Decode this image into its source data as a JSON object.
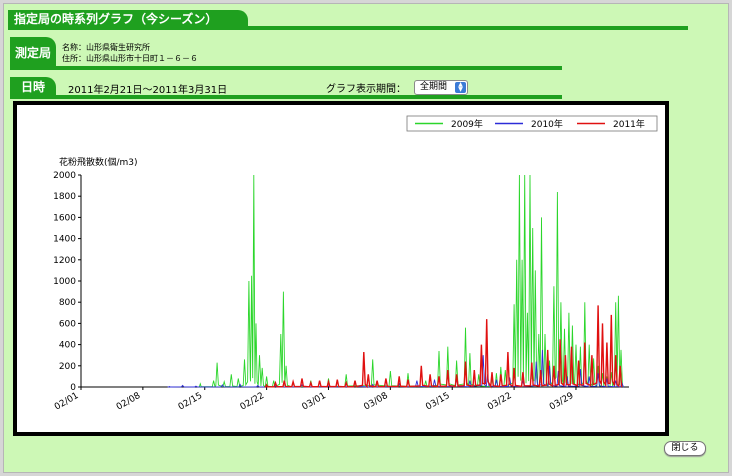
{
  "header": {
    "title": "指定局の時系列グラフ（今シーズン）"
  },
  "station": {
    "label": "測定局",
    "name": "名称：山形県衛生研究所",
    "address": "住所：山形県山形市十日町１－６－６"
  },
  "period": {
    "label": "日時",
    "range": "2011年2月21日～2011年3月31日",
    "display_label": "グラフ表示期間：",
    "display_value": "全期間"
  },
  "close_label": "閉じる",
  "colors": {
    "green": "#2bd62b",
    "blue": "#2c2cd8",
    "red": "#e01010",
    "accent": "#1fa01f"
  },
  "chart_data": {
    "type": "line",
    "ylabel": "花粉飛散数(個/m3)",
    "ylim": [
      0,
      2000
    ],
    "yticks": [
      "2000",
      "1800",
      "1600",
      "1400",
      "1200",
      "1000",
      "800",
      "600",
      "400",
      "200",
      "0"
    ],
    "xticks": [
      "02/01",
      "02/08",
      "02/15",
      "02/22",
      "03/01",
      "03/08",
      "03/15",
      "03/22",
      "03/29"
    ],
    "xlim_days": [
      0,
      62
    ],
    "legend_position": "top-right",
    "series": [
      {
        "name": "2009年",
        "color": "#2bd62b",
        "peaks": [
          [
            13.5,
            30
          ],
          [
            15.0,
            60
          ],
          [
            15.4,
            230
          ],
          [
            16.2,
            50
          ],
          [
            17.0,
            120
          ],
          [
            17.8,
            80
          ],
          [
            18.5,
            260
          ],
          [
            19.0,
            1000
          ],
          [
            19.3,
            1050
          ],
          [
            19.55,
            2000
          ],
          [
            19.8,
            600
          ],
          [
            20.2,
            300
          ],
          [
            20.5,
            180
          ],
          [
            21.0,
            100
          ],
          [
            21.8,
            60
          ],
          [
            22.6,
            500
          ],
          [
            22.9,
            900
          ],
          [
            23.2,
            200
          ],
          [
            24.0,
            40
          ],
          [
            26.0,
            60
          ],
          [
            28.0,
            80
          ],
          [
            30.0,
            120
          ],
          [
            33.0,
            260
          ],
          [
            35.0,
            150
          ],
          [
            37.0,
            130
          ],
          [
            39.0,
            60
          ],
          [
            40.5,
            340
          ],
          [
            41.5,
            380
          ],
          [
            42.5,
            250
          ],
          [
            43.5,
            560
          ],
          [
            44.0,
            320
          ],
          [
            45.0,
            120
          ],
          [
            46.5,
            80
          ],
          [
            47.0,
            130
          ],
          [
            47.5,
            190
          ],
          [
            48.0,
            160
          ],
          [
            49.0,
            780
          ],
          [
            49.3,
            1200
          ],
          [
            49.6,
            2000
          ],
          [
            49.9,
            1200
          ],
          [
            50.2,
            2000
          ],
          [
            50.5,
            700
          ],
          [
            50.8,
            2000
          ],
          [
            51.1,
            1500
          ],
          [
            51.4,
            1100
          ],
          [
            51.8,
            500
          ],
          [
            52.1,
            1600
          ],
          [
            52.5,
            500
          ],
          [
            53.0,
            250
          ],
          [
            53.5,
            950
          ],
          [
            53.9,
            1840
          ],
          [
            54.3,
            800
          ],
          [
            54.7,
            550
          ],
          [
            55.2,
            700
          ],
          [
            55.6,
            580
          ],
          [
            56.0,
            400
          ],
          [
            56.5,
            380
          ],
          [
            57.0,
            800
          ],
          [
            57.5,
            400
          ],
          [
            58.0,
            270
          ],
          [
            58.5,
            200
          ],
          [
            59.0,
            130
          ],
          [
            59.5,
            100
          ],
          [
            60.0,
            140
          ],
          [
            60.5,
            800
          ],
          [
            60.8,
            860
          ],
          [
            61.1,
            350
          ]
        ]
      },
      {
        "name": "2010年",
        "color": "#2c2cd8",
        "peaks": [
          [
            10.0,
            5
          ],
          [
            11.5,
            15
          ],
          [
            13.0,
            8
          ],
          [
            16.0,
            20
          ],
          [
            18.0,
            25
          ],
          [
            20.0,
            15
          ],
          [
            22.0,
            10
          ],
          [
            25.0,
            20
          ],
          [
            28.0,
            10
          ],
          [
            31.0,
            60
          ],
          [
            33.0,
            25
          ],
          [
            36.0,
            30
          ],
          [
            38.0,
            60
          ],
          [
            40.0,
            70
          ],
          [
            42.5,
            80
          ],
          [
            44.0,
            60
          ],
          [
            45.5,
            300
          ],
          [
            46.0,
            120
          ],
          [
            47.0,
            70
          ],
          [
            48.5,
            90
          ],
          [
            50.0,
            60
          ],
          [
            51.5,
            240
          ],
          [
            52.2,
            350
          ],
          [
            53.0,
            200
          ],
          [
            54.0,
            150
          ],
          [
            55.0,
            100
          ],
          [
            56.5,
            170
          ],
          [
            57.5,
            100
          ],
          [
            58.5,
            130
          ],
          [
            59.5,
            80
          ],
          [
            60.5,
            60
          ],
          [
            61.2,
            40
          ]
        ]
      },
      {
        "name": "2011年",
        "color": "#e01010",
        "peaks": [
          [
            21.0,
            20
          ],
          [
            22.0,
            40
          ],
          [
            23.0,
            60
          ],
          [
            24.0,
            50
          ],
          [
            25.0,
            80
          ],
          [
            26.0,
            40
          ],
          [
            27.0,
            60
          ],
          [
            28.0,
            50
          ],
          [
            29.0,
            70
          ],
          [
            30.0,
            40
          ],
          [
            31.0,
            60
          ],
          [
            32.0,
            330
          ],
          [
            32.5,
            120
          ],
          [
            33.5,
            60
          ],
          [
            34.5,
            80
          ],
          [
            36.0,
            100
          ],
          [
            37.0,
            70
          ],
          [
            38.5,
            200
          ],
          [
            39.5,
            120
          ],
          [
            40.5,
            100
          ],
          [
            41.5,
            160
          ],
          [
            42.5,
            120
          ],
          [
            43.5,
            240
          ],
          [
            44.5,
            160
          ],
          [
            45.3,
            400
          ],
          [
            45.9,
            640
          ],
          [
            46.5,
            140
          ],
          [
            47.5,
            120
          ],
          [
            48.3,
            330
          ],
          [
            49.0,
            180
          ],
          [
            50.0,
            140
          ],
          [
            51.0,
            230
          ],
          [
            52.0,
            160
          ],
          [
            52.8,
            350
          ],
          [
            53.5,
            200
          ],
          [
            54.2,
            450
          ],
          [
            54.8,
            300
          ],
          [
            55.5,
            380
          ],
          [
            56.3,
            250
          ],
          [
            57.0,
            420
          ],
          [
            57.8,
            300
          ],
          [
            58.5,
            770
          ],
          [
            59.0,
            600
          ],
          [
            59.5,
            420
          ],
          [
            60.0,
            680
          ],
          [
            60.5,
            300
          ],
          [
            61.0,
            200
          ]
        ]
      }
    ]
  }
}
